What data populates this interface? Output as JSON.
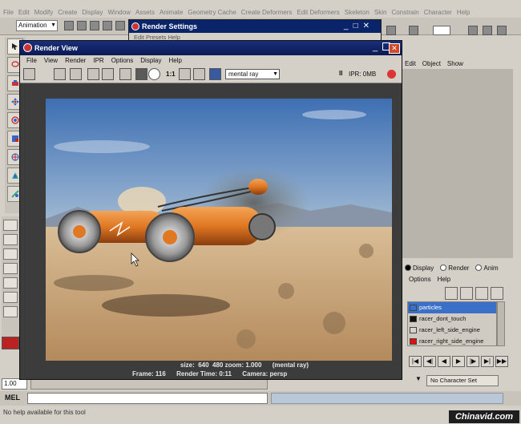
{
  "maya": {
    "menubar": [
      "File",
      "Edit",
      "Modify",
      "Create",
      "Display",
      "Window",
      "Assets",
      "Animate",
      "Geometry Cache",
      "Create Deformers",
      "Edit Deformers",
      "Skeleton",
      "Skin",
      "Constrain",
      "Character",
      "Help"
    ],
    "mode": "Animation",
    "right_menu": [
      "Edit",
      "Object",
      "Show"
    ],
    "layer_radios": [
      "Display",
      "Render",
      "Anim"
    ],
    "layer_menu": [
      "Options",
      "Help"
    ],
    "layers": [
      {
        "name": "particles",
        "color": "#3a70c8",
        "selected": true
      },
      {
        "name": "racer_dont_touch",
        "color": "#111111",
        "selected": false
      },
      {
        "name": "racer_left_side_engine",
        "color": "#d8d4cc",
        "selected": false
      },
      {
        "name": "racer_right_side_engine",
        "color": "#e01010",
        "selected": false
      }
    ],
    "time_field": "1.00",
    "character_set": "No Character Set",
    "mel_label": "MEL",
    "help_text": "No help available for this tool"
  },
  "render_settings": {
    "title": "Render Settings",
    "menu": "Edit  Presets  Help"
  },
  "render_view": {
    "title": "Render View",
    "menu": [
      "File",
      "View",
      "Render",
      "IPR",
      "Options",
      "Display",
      "Help"
    ],
    "zoom_label": "1:1",
    "renderer": "mental ray",
    "ipr_status": "IPR: 0MB",
    "info_line1": "size:  640  480 zoom: 1.000      (mental ray)",
    "info_line2": "Frame: 116      Render Time: 0:11      Camera: persp"
  },
  "watermark": "Chinavid.com",
  "colors": {
    "sky_top": "#3d6fb3",
    "sky_bottom": "#9fb8d0",
    "sand": "#c9a679",
    "pod_orange": "#e07722",
    "titlebar": "#0a246a"
  }
}
